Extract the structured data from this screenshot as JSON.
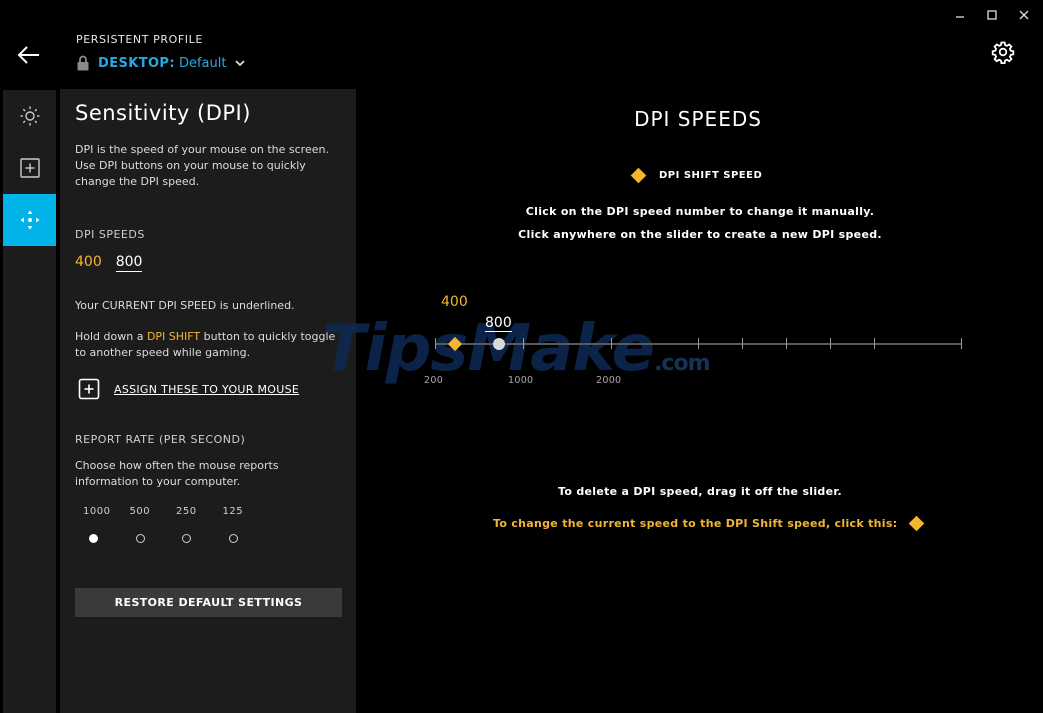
{
  "header": {
    "profile_type": "PERSISTENT PROFILE",
    "profile_group": "DESKTOP:",
    "profile_name": "Default"
  },
  "panel": {
    "title": "Sensitivity (DPI)",
    "description": "DPI is the speed of your mouse on the screen. Use DPI buttons on your mouse to quickly change the DPI speed.",
    "dpi_speeds_label": "DPI SPEEDS",
    "dpi_values": [
      "400",
      "800"
    ],
    "current_note": "Your CURRENT DPI SPEED is underlined.",
    "shift_note_prefix": "Hold down a ",
    "shift_note_highlight": "DPI SHIFT",
    "shift_note_suffix": " button to quickly toggle to another speed while gaming.",
    "assign_label": "ASSIGN THESE TO YOUR MOUSE",
    "report_rate_label": "REPORT RATE (PER SECOND)",
    "report_rate_desc": "Choose how often the mouse reports information to your computer.",
    "report_rates": [
      "1000",
      "500",
      "250",
      "125"
    ],
    "report_rate_selected": "1000",
    "restore_label": "RESTORE DEFAULT SETTINGS"
  },
  "main": {
    "title": "DPI SPEEDS",
    "legend_label": "DPI SHIFT SPEED",
    "instruction_1": "Click on the DPI speed number to change it manually.",
    "instruction_2": "Click anywhere on the slider to create a new DPI speed.",
    "slider": {
      "shift_value": "400",
      "current_value": "800",
      "tick_labels": [
        "200",
        "1000",
        "2000"
      ]
    },
    "delete_note": "To delete a DPI speed, drag it off the slider.",
    "shift_instruction": "To change the current speed to the DPI Shift speed, click this:"
  },
  "watermark": {
    "text": "TipsMake",
    "suffix": ".com"
  },
  "colors": {
    "accent_blue": "#00b4ea",
    "profile_blue": "#2aa7e3",
    "shift_yellow": "#f2b632",
    "panel_bg": "#1c1c1c"
  },
  "icons": {
    "back": "arrow-left-icon",
    "lock": "lock-icon",
    "chevron": "chevron-down-icon",
    "settings": "gear-icon",
    "nav_lighting": "sun-icon",
    "nav_assignments": "plus-square-icon",
    "nav_pointer": "move-arrows-icon",
    "assign": "plus-square-icon"
  }
}
